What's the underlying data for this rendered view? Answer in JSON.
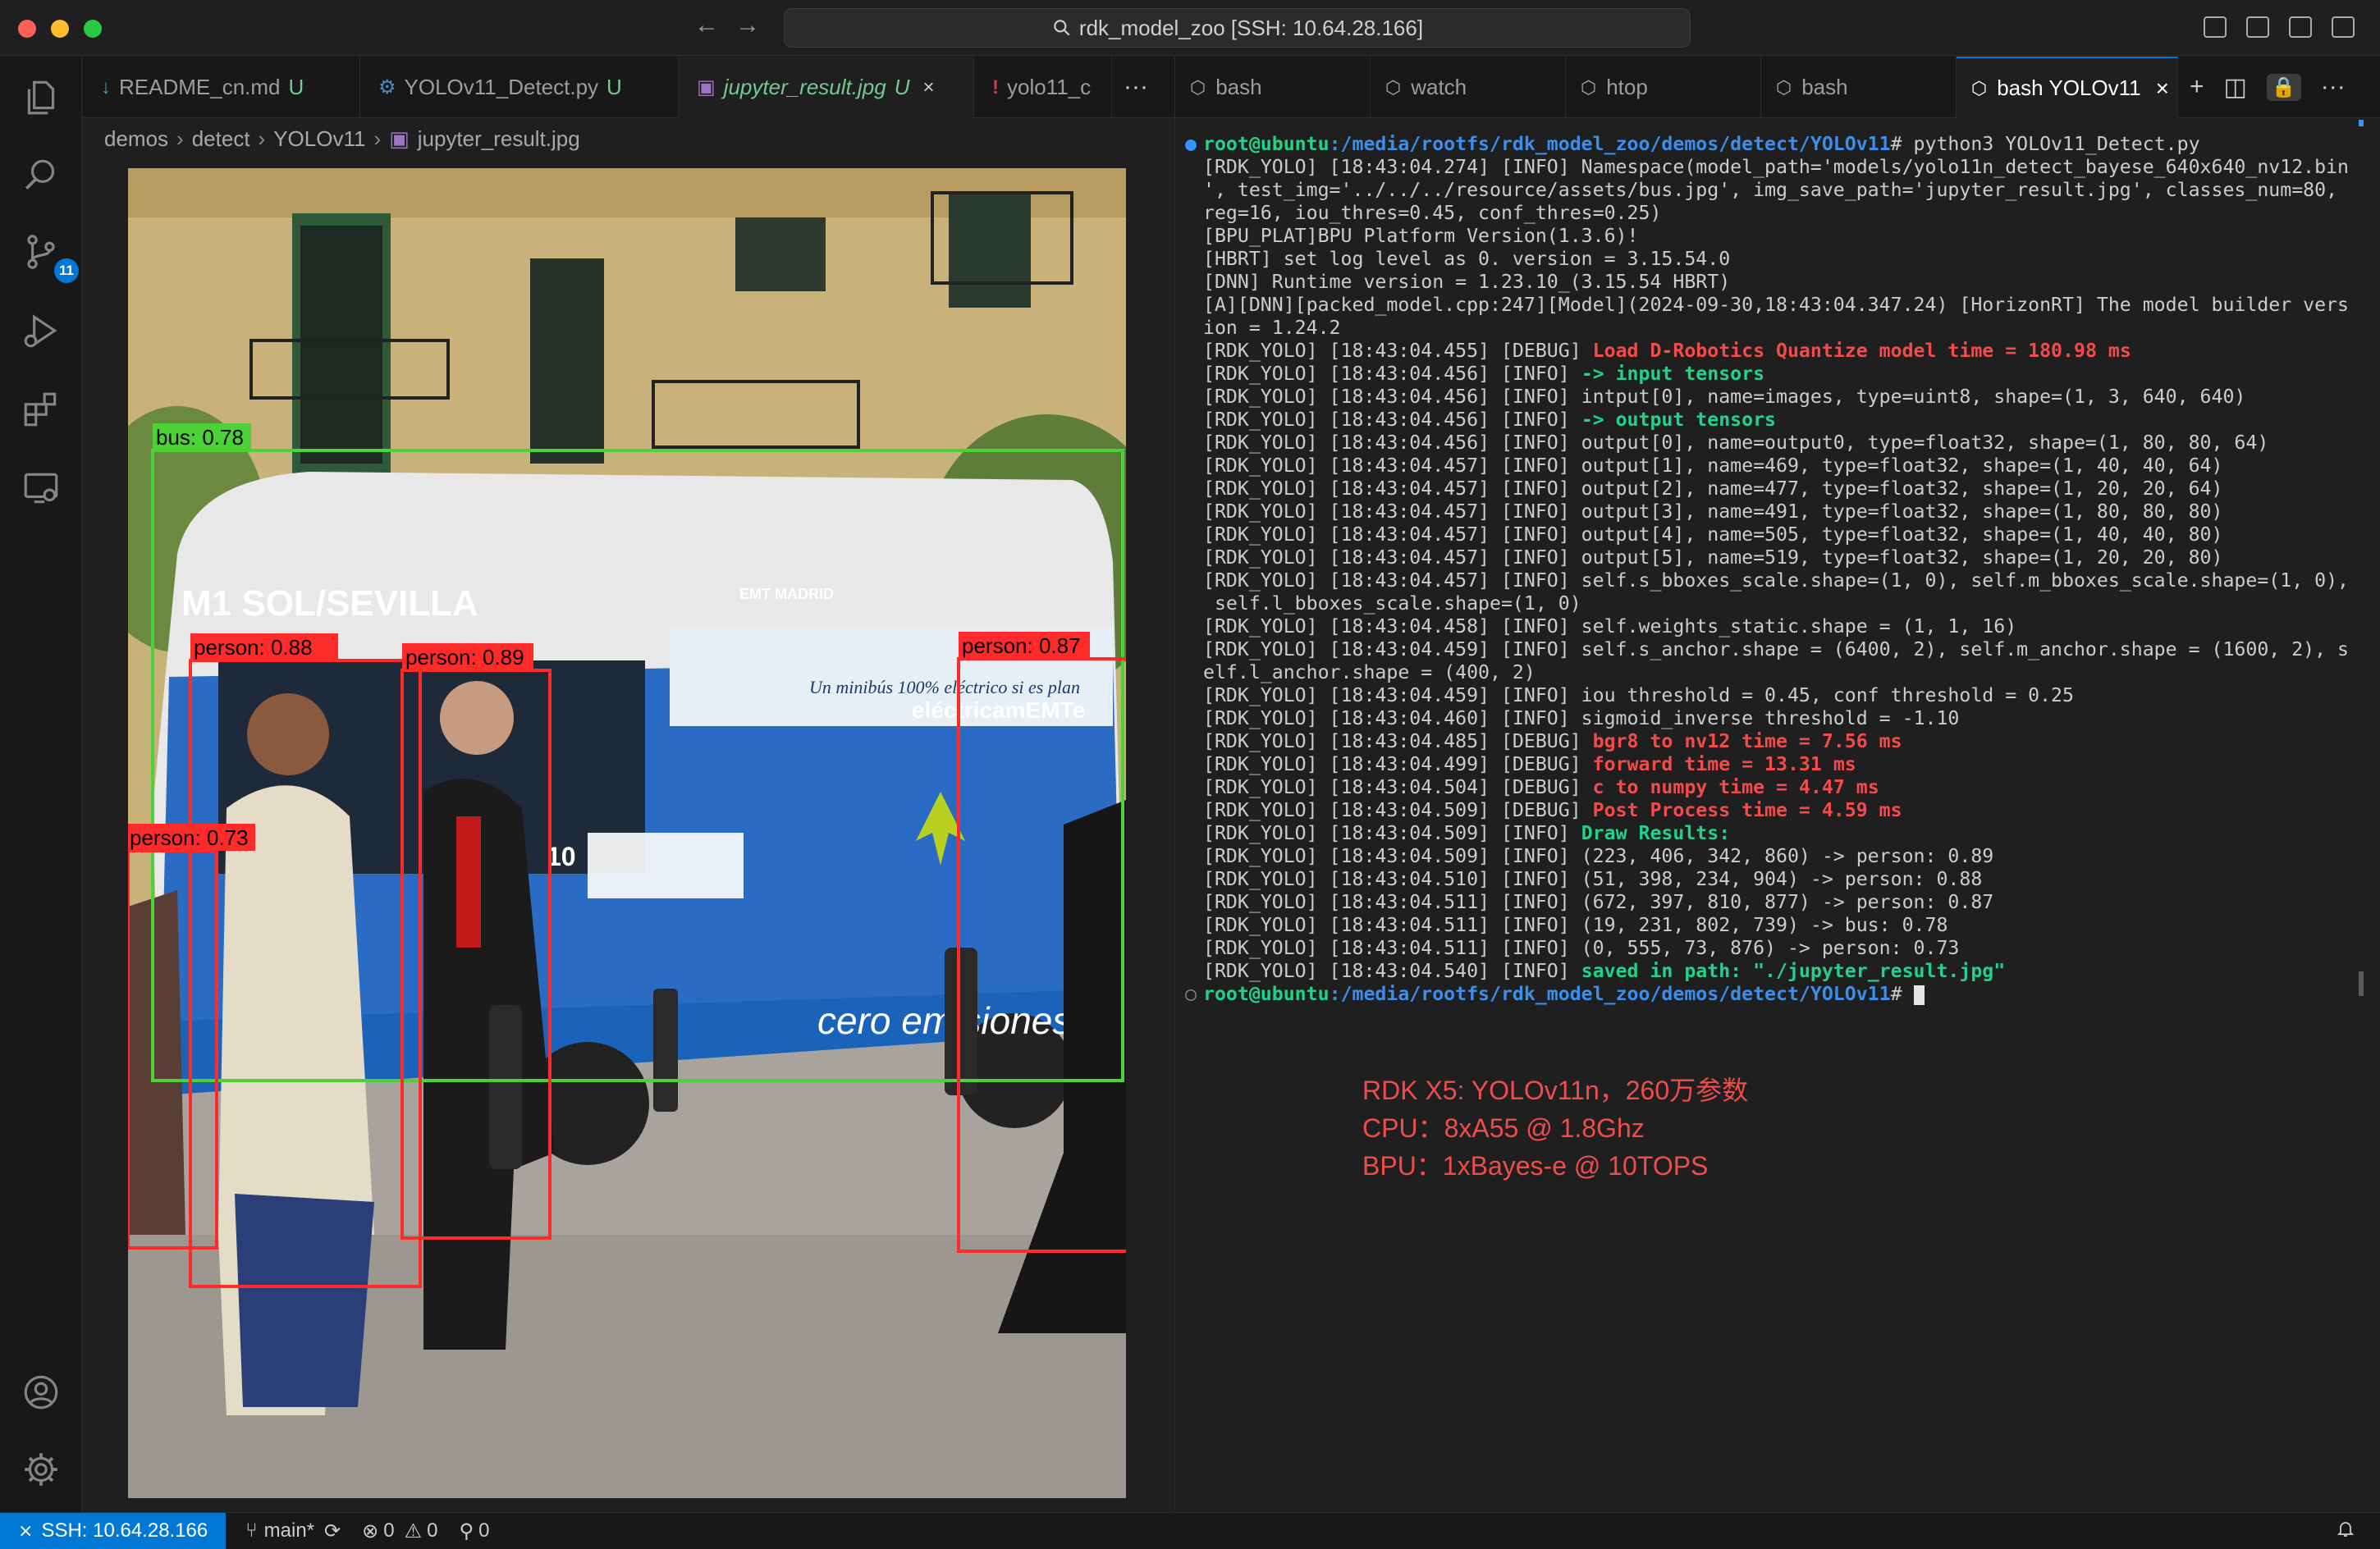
{
  "window": {
    "search_text": "rdk_model_zoo [SSH: 10.64.28.166]"
  },
  "activity_bar": {
    "scm_badge": "11"
  },
  "editor": {
    "tabs": [
      {
        "icon": "↓",
        "label": "README_cn.md",
        "status": "U"
      },
      {
        "icon": "⚙",
        "label": "YOLOv11_Detect.py",
        "status": "U"
      },
      {
        "icon": "▣",
        "label": "jupyter_result.jpg",
        "status": "U",
        "close": "×"
      },
      {
        "icon": "!",
        "label": "yolo11_c",
        "status": ""
      }
    ],
    "more": "···",
    "breadcrumb": [
      "demos",
      "detect",
      "YOLOv11",
      "jupyter_result.jpg"
    ]
  },
  "image": {
    "detections": [
      {
        "label": "bus: 0.78",
        "color": "#4cd137"
      },
      {
        "label": "person: 0.88",
        "color": "#ff2a2a"
      },
      {
        "label": "person: 0.89",
        "color": "#ff2a2a"
      },
      {
        "label": "person: 0.87",
        "color": "#ff2a2a"
      },
      {
        "label": "person: 0.73",
        "color": "#ff2a2a"
      }
    ],
    "bus_sign": "M1 SOL/SEVILLA",
    "bus_banner": "Un minibús 100% eléctrico si es plan",
    "bus_brand": "eléctricamEMTe",
    "bus_slogan": "cero emisiones",
    "bus_emt": "EMT MADRID",
    "bus_number": "10"
  },
  "terminal": {
    "tabs": [
      {
        "label": "bash"
      },
      {
        "label": "watch"
      },
      {
        "label": "htop"
      },
      {
        "label": "bash"
      },
      {
        "label": "bash  YOLOv11",
        "close": "×"
      }
    ],
    "actions": [
      "+",
      "◫",
      "🔒",
      "···"
    ],
    "prompt_user": "root@ubuntu",
    "prompt_path": ":/media/rootfs/rdk_model_zoo/demos/detect/YOLOv11",
    "command": "# python3 YOLOv11_Detect.py",
    "lines": [
      {
        "t": "[RDK_YOLO] [18:43:04.274] [INFO] Namespace(model_path='models/yolo11n_detect_bayese_640x640_nv12.bin"
      },
      {
        "t": "', test_img='../../../resource/assets/bus.jpg', img_save_path='jupyter_result.jpg', classes_num=80,"
      },
      {
        "t": "reg=16, iou_thres=0.45, conf_thres=0.25)"
      },
      {
        "t": "[BPU_PLAT]BPU Platform Version(1.3.6)!"
      },
      {
        "t": "[HBRT] set log level as 0. version = 3.15.54.0"
      },
      {
        "t": "[DNN] Runtime version = 1.23.10_(3.15.54 HBRT)"
      },
      {
        "t": "[A][DNN][packed_model.cpp:247][Model](2024-09-30,18:43:04.347.24) [HorizonRT] The model builder vers"
      },
      {
        "t": "ion = 1.24.2"
      },
      {
        "t": "[RDK_YOLO] [18:43:04.455] [DEBUG] ",
        "hl": "Load D-Robotics Quantize model time = 180.98 ms",
        "c": "red"
      },
      {
        "t": "[RDK_YOLO] [18:43:04.456] [INFO] ",
        "hl": "-> input tensors",
        "c": "green"
      },
      {
        "t": "[RDK_YOLO] [18:43:04.456] [INFO] intput[0], name=images, type=uint8, shape=(1, 3, 640, 640)"
      },
      {
        "t": "[RDK_YOLO] [18:43:04.456] [INFO] ",
        "hl": "-> output tensors",
        "c": "green"
      },
      {
        "t": "[RDK_YOLO] [18:43:04.456] [INFO] output[0], name=output0, type=float32, shape=(1, 80, 80, 64)"
      },
      {
        "t": "[RDK_YOLO] [18:43:04.457] [INFO] output[1], name=469, type=float32, shape=(1, 40, 40, 64)"
      },
      {
        "t": "[RDK_YOLO] [18:43:04.457] [INFO] output[2], name=477, type=float32, shape=(1, 20, 20, 64)"
      },
      {
        "t": "[RDK_YOLO] [18:43:04.457] [INFO] output[3], name=491, type=float32, shape=(1, 80, 80, 80)"
      },
      {
        "t": "[RDK_YOLO] [18:43:04.457] [INFO] output[4], name=505, type=float32, shape=(1, 40, 40, 80)"
      },
      {
        "t": "[RDK_YOLO] [18:43:04.457] [INFO] output[5], name=519, type=float32, shape=(1, 20, 20, 80)"
      },
      {
        "t": "[RDK_YOLO] [18:43:04.457] [INFO] self.s_bboxes_scale.shape=(1, 0), self.m_bboxes_scale.shape=(1, 0),"
      },
      {
        "t": " self.l_bboxes_scale.shape=(1, 0)"
      },
      {
        "t": "[RDK_YOLO] [18:43:04.458] [INFO] self.weights_static.shape = (1, 1, 16)"
      },
      {
        "t": "[RDK_YOLO] [18:43:04.459] [INFO] self.s_anchor.shape = (6400, 2), self.m_anchor.shape = (1600, 2), s"
      },
      {
        "t": "elf.l_anchor.shape = (400, 2)"
      },
      {
        "t": "[RDK_YOLO] [18:43:04.459] [INFO] iou threshold = 0.45, conf threshold = 0.25"
      },
      {
        "t": "[RDK_YOLO] [18:43:04.460] [INFO] sigmoid_inverse threshold = -1.10"
      },
      {
        "t": "[RDK_YOLO] [18:43:04.485] [DEBUG] ",
        "hl": "bgr8 to nv12 time = 7.56 ms",
        "c": "red"
      },
      {
        "t": "[RDK_YOLO] [18:43:04.499] [DEBUG] ",
        "hl": "forward time = 13.31 ms",
        "c": "red"
      },
      {
        "t": "[RDK_YOLO] [18:43:04.504] [DEBUG] ",
        "hl": "c to numpy time = 4.47 ms",
        "c": "red"
      },
      {
        "t": "[RDK_YOLO] [18:43:04.509] [DEBUG] ",
        "hl": "Post Process time = 4.59 ms",
        "c": "red"
      },
      {
        "t": "[RDK_YOLO] [18:43:04.509] [INFO] ",
        "hl": "Draw Results:",
        "c": "green"
      },
      {
        "t": "[RDK_YOLO] [18:43:04.509] [INFO] (223, 406, 342, 860) -> person: 0.89"
      },
      {
        "t": "[RDK_YOLO] [18:43:04.510] [INFO] (51, 398, 234, 904) -> person: 0.88"
      },
      {
        "t": "[RDK_YOLO] [18:43:04.511] [INFO] (672, 397, 810, 877) -> person: 0.87"
      },
      {
        "t": "[RDK_YOLO] [18:43:04.511] [INFO] (19, 231, 802, 739) -> bus: 0.78"
      },
      {
        "t": "[RDK_YOLO] [18:43:04.511] [INFO] (0, 555, 73, 876) -> person: 0.73"
      },
      {
        "t": "[RDK_YOLO] [18:43:04.540] [INFO] ",
        "hl": "saved in path: \"./jupyter_result.jpg\"",
        "c": "green"
      }
    ],
    "final_prompt_suffix": "# "
  },
  "specs": [
    "RDK X5: YOLOv11n，260万参数",
    "CPU：8xA55 @ 1.8Ghz",
    "BPU：1xBayes-e @ 10TOPS"
  ],
  "status_bar": {
    "remote": "SSH: 10.64.28.166",
    "branch": "main*",
    "errors": "0",
    "warnings": "0",
    "ports": "0"
  },
  "colors": {
    "accent": "#0078d4",
    "terminal_red": "#f14c4c",
    "terminal_green": "#23d18b",
    "terminal_blue": "#3b8eea"
  }
}
